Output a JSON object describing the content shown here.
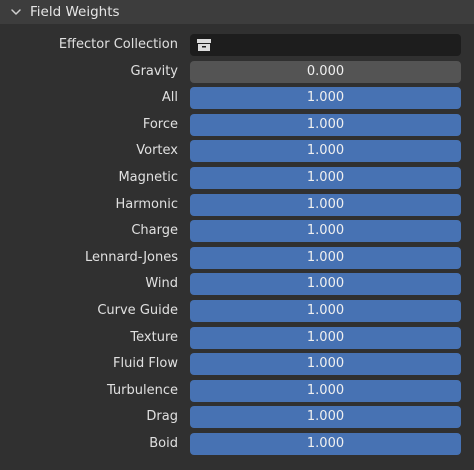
{
  "panel": {
    "title": "Field Weights",
    "collapsed": false
  },
  "colors": {
    "slider_fill": "#4772b3",
    "slider_zero": "#545454",
    "collection_field": "#1d1d1d",
    "header_bg": "#3d3d3d",
    "panel_bg": "#303030"
  },
  "effector_collection": {
    "label": "Effector Collection",
    "value": "",
    "icon": "collection-box-icon"
  },
  "weights": [
    {
      "label": "Gravity",
      "value": "0.000"
    },
    {
      "label": "All",
      "value": "1.000"
    },
    {
      "label": "Force",
      "value": "1.000"
    },
    {
      "label": "Vortex",
      "value": "1.000"
    },
    {
      "label": "Magnetic",
      "value": "1.000"
    },
    {
      "label": "Harmonic",
      "value": "1.000"
    },
    {
      "label": "Charge",
      "value": "1.000"
    },
    {
      "label": "Lennard-Jones",
      "value": "1.000"
    },
    {
      "label": "Wind",
      "value": "1.000"
    },
    {
      "label": "Curve Guide",
      "value": "1.000"
    },
    {
      "label": "Texture",
      "value": "1.000"
    },
    {
      "label": "Fluid Flow",
      "value": "1.000"
    },
    {
      "label": "Turbulence",
      "value": "1.000"
    },
    {
      "label": "Drag",
      "value": "1.000"
    },
    {
      "label": "Boid",
      "value": "1.000"
    }
  ]
}
